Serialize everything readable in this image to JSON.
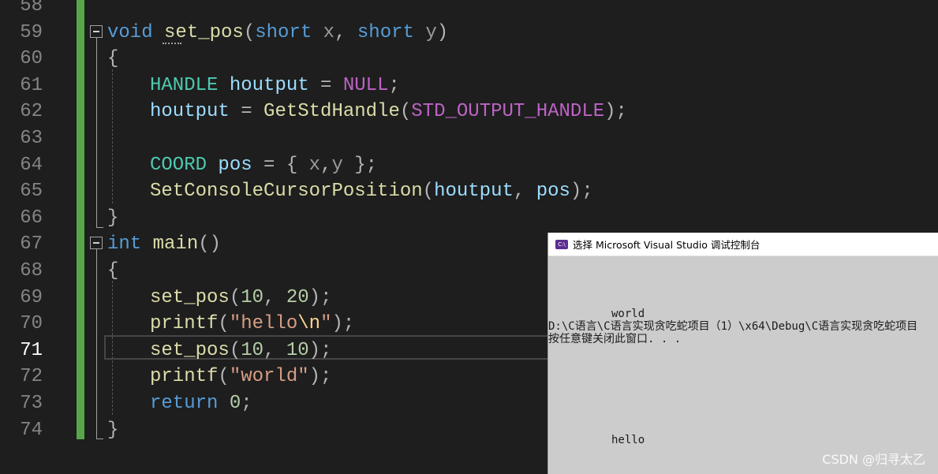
{
  "editor": {
    "line_numbers": [
      "58",
      "59",
      "60",
      "61",
      "62",
      "63",
      "64",
      "65",
      "66",
      "67",
      "68",
      "69",
      "70",
      "71",
      "72",
      "73",
      "74"
    ],
    "current_line": "71",
    "code": {
      "l59": {
        "t1": "void",
        "t2": "set_pos",
        "t3": "(",
        "t4": "short",
        "t5": "x",
        "t6": ", ",
        "t7": "short",
        "t8": "y",
        "t9": ")"
      },
      "l60": {
        "t1": "{"
      },
      "l61": {
        "t1": "HANDLE",
        "t2": "houtput",
        "t3": " = ",
        "t4": "NULL",
        "t5": ";"
      },
      "l62": {
        "t1": "houtput",
        "t2": " = ",
        "t3": "GetStdHandle",
        "t4": "(",
        "t5": "STD_OUTPUT_HANDLE",
        "t6": ");"
      },
      "l64": {
        "t1": "COORD",
        "t2": "pos",
        "t3": " = { ",
        "t4": "x",
        "t5": ",",
        "t6": "y",
        "t7": " };"
      },
      "l65": {
        "t1": "SetConsoleCursorPosition",
        "t2": "(",
        "t3": "houtput",
        "t4": ", ",
        "t5": "pos",
        "t6": ");"
      },
      "l66": {
        "t1": "}"
      },
      "l67": {
        "t1": "int",
        "t2": "main",
        "t3": "()"
      },
      "l68": {
        "t1": "{"
      },
      "l69": {
        "t1": "set_pos",
        "t2": "(",
        "t3": "10",
        "t4": ", ",
        "t5": "20",
        "t6": ");"
      },
      "l70": {
        "t1": "printf",
        "t2": "(",
        "t3": "\"hello",
        "t4": "\\n",
        "t5": "\"",
        "t6": ");"
      },
      "l71": {
        "t1": "set_pos",
        "t2": "(",
        "t3": "10",
        "t4": ", ",
        "t5": "10",
        "t6": ");"
      },
      "l72": {
        "t1": "printf",
        "t2": "(",
        "t3": "\"world\"",
        "t4": ");"
      },
      "l73": {
        "t1": "return",
        "t2": " ",
        "t3": "0",
        "t4": ";"
      },
      "l74": {
        "t1": "}"
      }
    }
  },
  "console": {
    "title": "选择 Microsoft Visual Studio 调试控制台",
    "icon_text": "C:\\",
    "lines": {
      "world": "world",
      "path": "D:\\C语言\\C语言实现贪吃蛇项目（1）\\x64\\Debug\\C语言实现贪吃蛇项目",
      "press": "按任意键关闭此窗口. . .",
      "hello": "hello"
    }
  },
  "watermark": "CSDN @归寻太乙",
  "colors": {
    "editor_bg": "#1e1e1e",
    "change_bar": "#57a64a",
    "console_bg": "#cccccc",
    "keyword": "#569cd6",
    "type": "#4ec9b0",
    "function": "#dcdcaa",
    "string": "#d69d85"
  }
}
